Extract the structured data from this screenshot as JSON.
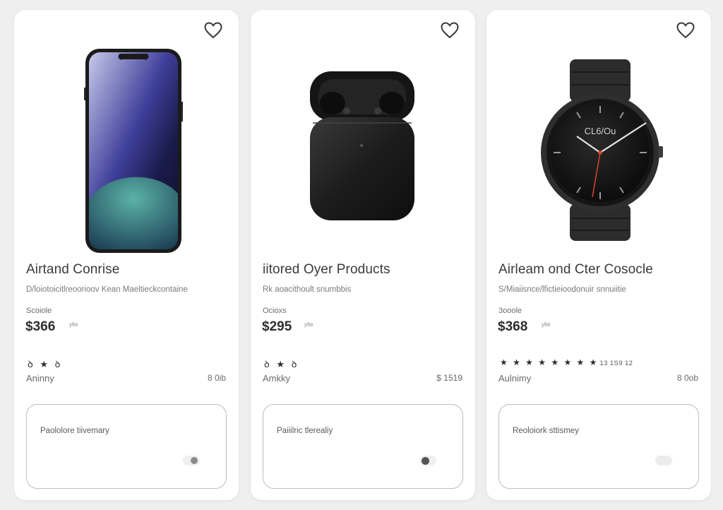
{
  "products": [
    {
      "title": "Airtand Conrise",
      "description": "D/loiotoicitlreoorioov Kean Maeltieckcontaine",
      "small_label": "Scoiole",
      "price": "$366",
      "price_note": "ylte",
      "rating_stars": "ꝺ ★ ꝺ",
      "rating_count": "",
      "availability": "Aninny",
      "stock": "8 0ib",
      "panel_label": "Paololore tiivemary",
      "toggle_state": "off",
      "image_icon": "smartphone",
      "favorite_icon": "heart-outline"
    },
    {
      "title": "iitored Oyer Products",
      "description": "Rk aoacithoult snumbbis",
      "small_label": "Ocioxs",
      "price": "$295",
      "price_note": "ylte",
      "rating_stars": "ꝺ ★ ꝺ",
      "rating_count": "",
      "availability": "Amkky",
      "stock": "$ 1519",
      "panel_label": "Paiiilric tlerealiy",
      "toggle_state": "on",
      "image_icon": "earbuds-case",
      "favorite_icon": "heart-outline"
    },
    {
      "title": "Airleam ond Cter Cosocle",
      "description": "S/Miaiisnce/lfictieioodonuir snnuiitie",
      "small_label": "3ooole",
      "price": "$368",
      "price_note": "ylte",
      "rating_stars": "★ ★ ★ ★ ★ ★ ★ ★",
      "rating_count": "13 1S9 12",
      "availability": "Aulnimy",
      "stock": "8 0ob",
      "panel_label": "Reoloiork sttismey",
      "toggle_state": "off-light",
      "image_icon": "smartwatch",
      "watch_face_text": "CL6/Ou",
      "favorite_icon": "heart-outline"
    }
  ],
  "colors": {
    "background": "#efefef",
    "card": "#ffffff",
    "panel_border": "#bdbdbd",
    "text_dark": "#2e2e2e",
    "text_muted": "#7a7a7a"
  }
}
